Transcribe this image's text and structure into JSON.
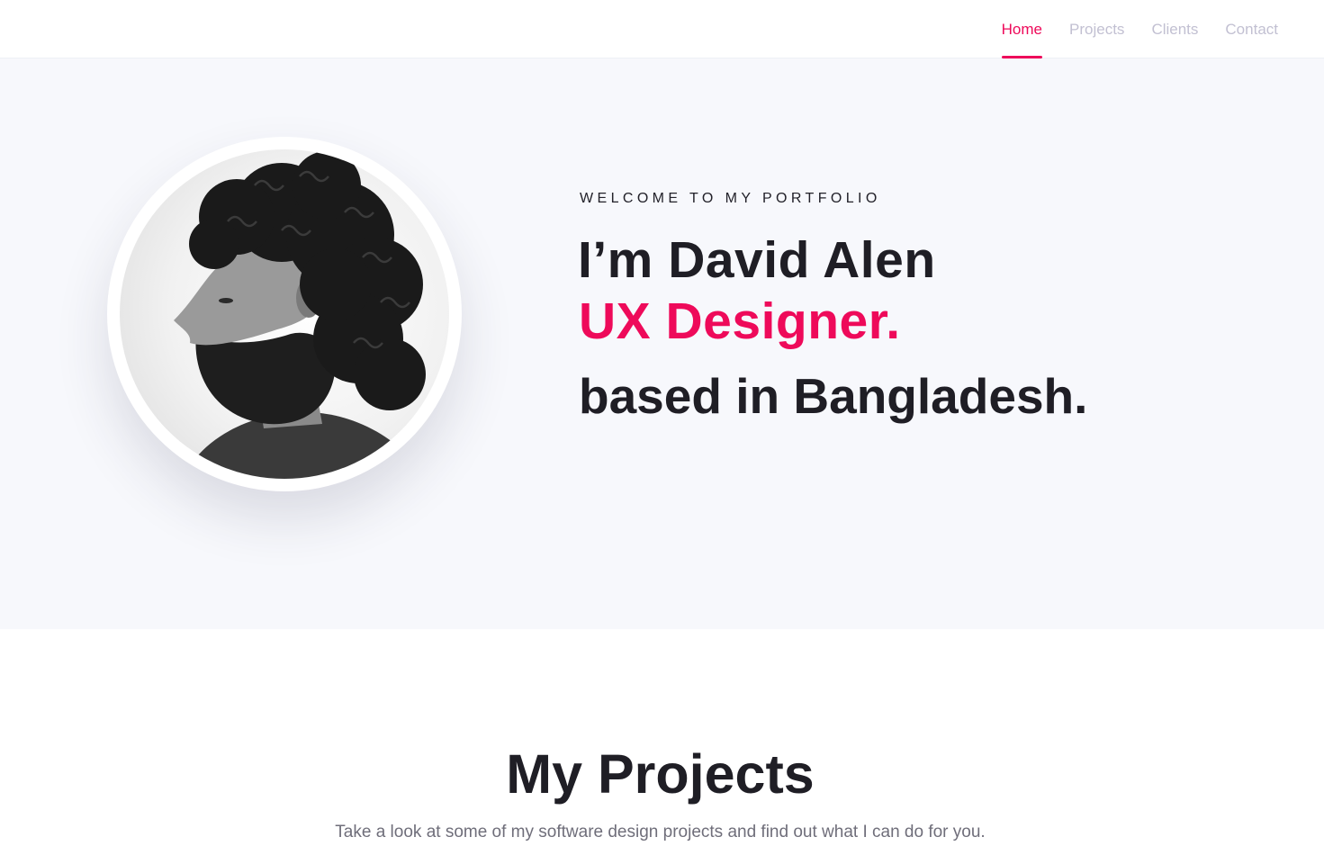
{
  "nav": {
    "items": [
      {
        "label": "Home",
        "active": true
      },
      {
        "label": "Projects",
        "active": false
      },
      {
        "label": "Clients",
        "active": false
      },
      {
        "label": "Contact",
        "active": false
      }
    ]
  },
  "hero": {
    "welcome": "WELCOME TO MY PORTFOLIO",
    "name_line": "I’m David Alen",
    "role_line": "UX Designer.",
    "location_line": "based in Bangladesh."
  },
  "projects": {
    "title": "My Projects",
    "subtitle": "Take a look at some of my software design projects and find out what I can do for you."
  },
  "colors": {
    "accent": "#ee0a5a",
    "heading": "#1f1e25",
    "nav_inactive": "#c2c0d2",
    "hero_background": "#f7f8fc"
  }
}
